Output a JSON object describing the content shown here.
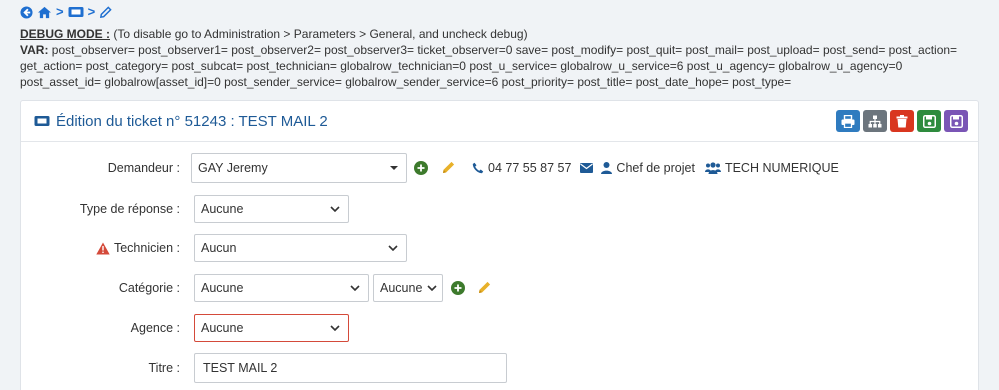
{
  "debug": {
    "title": "DEBUG MODE :",
    "note": " (To disable go to Administration > Parameters > General, and uncheck debug)",
    "var_label": "VAR:",
    "var_line1": " post_observer= post_observer1= post_observer2= post_observer3= ticket_observer=0 save= post_modify= post_quit= post_mail= post_upload= post_send= post_action=",
    "var_line2": "get_action= post_category= post_subcat= post_technician= globalrow_technician=0 post_u_service= globalrow_u_service=6 post_u_agency= globalrow_u_agency=0",
    "var_line3": "post_asset_id= globalrow[asset_id]=0 post_sender_service= globalrow_sender_service=6 post_priority= post_title= post_date_hope= post_type="
  },
  "breadcrumb": {
    "icons": [
      "back-icon",
      "home-icon",
      "ticket-icon",
      "pencil-icon"
    ],
    "separator": ">"
  },
  "ticket": {
    "title": "Édition du ticket n° 51243 : TEST MAIL 2"
  },
  "form": {
    "demandeur": {
      "label": "Demandeur :",
      "value": "GAY Jeremy",
      "phone": "04 77 55 87 57",
      "function": "Chef de projet",
      "service": "TECH NUMERIQUE"
    },
    "type_reponse": {
      "label": "Type de réponse :",
      "value": "Aucune"
    },
    "technicien": {
      "label": "Technicien :",
      "value": "Aucun"
    },
    "categorie": {
      "label": "Catégorie :",
      "value": "Aucune",
      "subcat_value": "Aucune"
    },
    "agence": {
      "label": "Agence :",
      "value": "Aucune"
    },
    "titre": {
      "label": "Titre :",
      "value": "TEST MAIL 2"
    }
  },
  "colors": {
    "accent": "#1e5a96",
    "print": "#2f7bbf",
    "tree": "#6c757d",
    "delete": "#d9361f",
    "save": "#2e8b3e",
    "save_close": "#7a55b5",
    "error": "#d44a3a",
    "add": "#3d7a2c",
    "edit": "#e8b12a"
  }
}
